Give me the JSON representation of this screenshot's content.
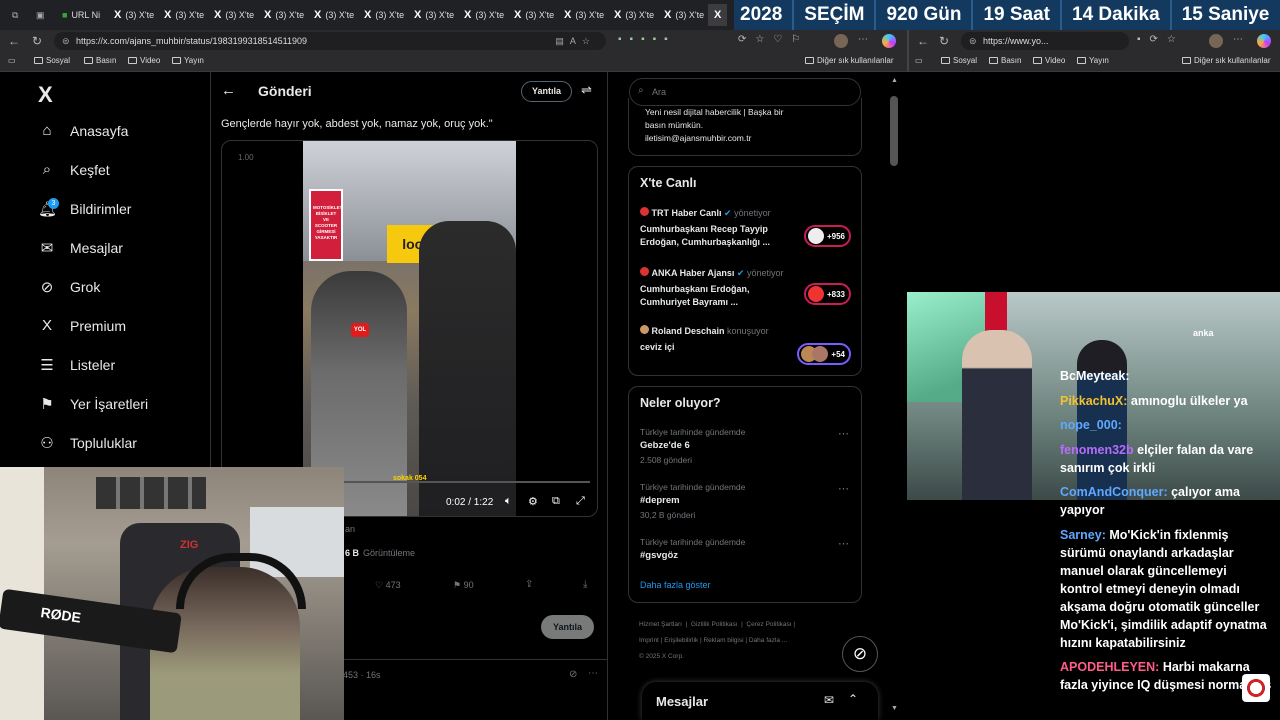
{
  "tabs": [
    "URL Ni",
    "(3) X'te",
    "(3) X'te",
    "(3) X'te",
    "(3) X'te",
    "(3) X'te",
    "(3) X'te",
    "(3) X'te",
    "(3) X'te",
    "(3) X'te",
    "(3) X'te",
    "(3) X'te",
    "(3) X'te"
  ],
  "countdown": [
    "2028",
    "SEÇİM",
    "920 Gün",
    "19 Saat",
    "14 Dakika",
    "15 Saniye"
  ],
  "url_main": "https://x.com/ajans_muhbir/status/1983199318514511909",
  "url_side": "https://www.yo...",
  "bookmarks": [
    "Sosyal",
    "Basın",
    "Video",
    "Yayın"
  ],
  "bookmarks_other": "Diğer sık kullanılanlar",
  "nav": {
    "logo": "X",
    "items": [
      "Anasayfa",
      "Keşfet",
      "Bildirimler",
      "Mesajlar",
      "Grok",
      "Premium",
      "Listeler",
      "Yer İşaretleri",
      "Topluluklar"
    ],
    "badge": "3"
  },
  "post": {
    "header": "Gönderi",
    "reply_btn": "Yantıla",
    "text": "Gençlerde hayır yok, abdest yok, namaz yok, oruç yok.\"",
    "video_time": "0:02 / 1:22",
    "video_left_label": "1.00",
    "views_suffix": "6 B",
    "views_label": "Görüntüleme",
    "author_frag": "an",
    "likes": "473",
    "bookmarks": "90",
    "reply_btn2": "Yantıla",
    "next_meta": "453 · 16s"
  },
  "video_overlay": {
    "sign": "MOTOSİKLET BİSİKLET VE SCOOTER GİRMESİ YASAKTIR",
    "store": "loop",
    "mic": "YOL",
    "watermark": "sokak 054"
  },
  "search": {
    "placeholder": "Ara"
  },
  "profile_card": {
    "line1": "Yeni nesil dijital habercilik | Başka bir",
    "line2": "basın mümkün.",
    "line3": "iletisim@ajansmuhbir.com.tr"
  },
  "live": {
    "title": "X'te Canlı",
    "items": [
      {
        "host": "TRT Haber Canlı",
        "role": "yönetiyor",
        "text1": "Cumhurbaşkanı Recep Tayyip",
        "text2": "Erdoğan, Cumhurbaşkanlığı ...",
        "count": "+956"
      },
      {
        "host": "ANKA Haber Ajansı",
        "role": "yönetiyor",
        "text1": "Cumhurbaşkanı Erdoğan,",
        "text2": "Cumhuriyet Bayramı ...",
        "count": "+833"
      },
      {
        "host": "Roland Deschain",
        "role": "konuşuyor",
        "text1": "ceviz içi",
        "text2": "",
        "count": "+54"
      }
    ]
  },
  "trends": {
    "title": "Neler oluyor?",
    "items": [
      {
        "context": "Türkiye tarihinde gündemde",
        "name": "Gebze'de 6",
        "count": "2.508 gönderi"
      },
      {
        "context": "Türkiye tarihinde gündemde",
        "name": "#deprem",
        "count": "30,2 B gönderi"
      },
      {
        "context": "Türkiye tarihinde gündemde",
        "name": "#gsvgöz",
        "count": ""
      }
    ],
    "show_more": "Daha fazla göster"
  },
  "footer": {
    "links": [
      "Hizmet Şartları",
      "Gizlilik Politikası",
      "Çerez Politikası",
      "Imprint",
      "Erişilebilirlik",
      "Reklam bilgisi",
      "Daha fazla ..."
    ],
    "copyright": "© 2025 X Corp."
  },
  "messages": {
    "title": "Mesajlar"
  },
  "stream": {
    "channel_tag": "anka",
    "mic_brand": "RØDE",
    "chair": "ZIG"
  },
  "chat": [
    {
      "user": "BcMeyteak:",
      "msg": "",
      "color": "#fff"
    },
    {
      "user": "PikkachuX:",
      "msg": "amınoglu ülkeler ya",
      "color": "#f2c230"
    },
    {
      "user": "nope_000:",
      "msg": "",
      "color": "#5fa8ff"
    },
    {
      "user": "fenomen32b",
      "msg": "elçiler falan da vare sanırım çok irkli",
      "color": "#b86bff"
    },
    {
      "user": "ComAndConquer:",
      "msg": "çalıyor ama yapıyor",
      "color": "#5fa8ff"
    },
    {
      "user": "Sarney:",
      "msg": "Mo'Kick'in fixlenmiş sürümü onaylandı arkadaşlar manuel olarak güncellemeyi kontrol etmeyi deneyin olmadı akşama doğru otomatik günceller Mo'Kick'i, şimdilik adaptif oynatma hızını kapatabilirsiniz",
      "color": "#5fa8ff"
    },
    {
      "user": "APODEHLEYEN:",
      "msg": "Harbi makarna fazla yiyince IQ düşmesi normalmiş",
      "color": "#ff5c8a"
    }
  ],
  "colors": {
    "x_blue": "#1d9bf0",
    "countdown_bg": "#13395e",
    "live_ring": "#c91c5d"
  }
}
